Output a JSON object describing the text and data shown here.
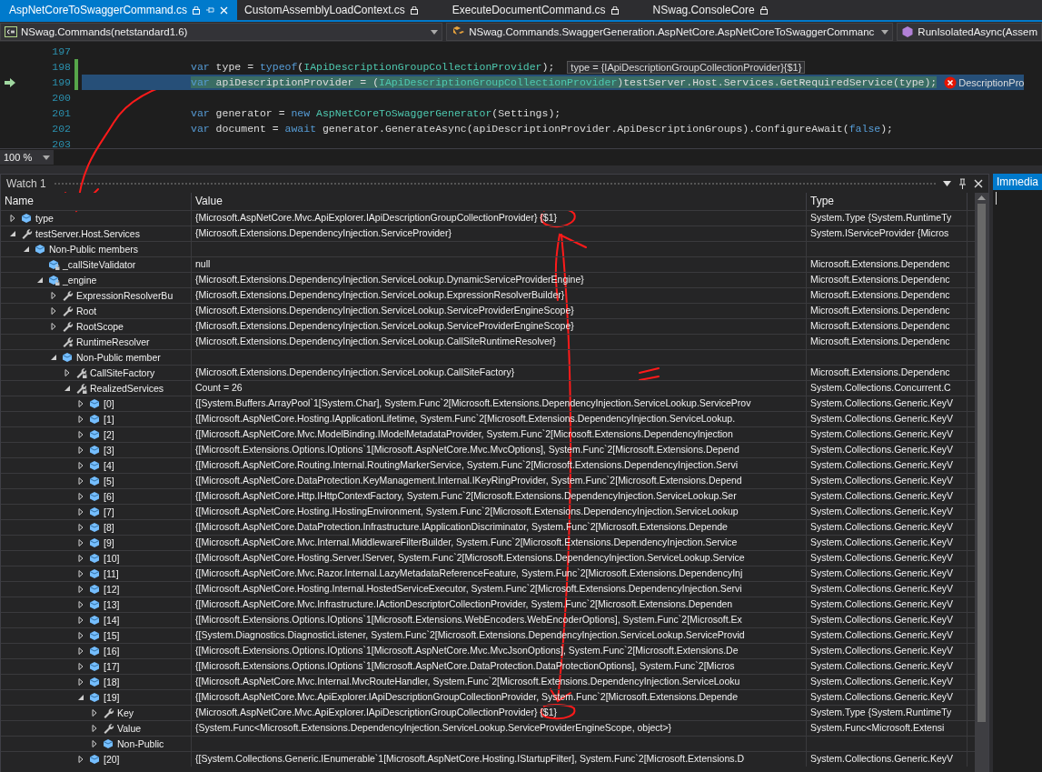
{
  "tabs": [
    {
      "label": "AspNetCoreToSwaggerCommand.cs",
      "selected": true,
      "pinnable": true
    },
    {
      "label": "CustomAssemblyLoadContext.cs",
      "selected": false,
      "pinnable": false
    },
    {
      "label": "ExecuteDocumentCommand.cs",
      "selected": false,
      "pinnable": false
    },
    {
      "label": "NSwag.ConsoleCore",
      "selected": false,
      "pinnable": false
    }
  ],
  "nav_bar": {
    "project": "NSwag.Commands(netstandard1.6)",
    "type": "NSwag.Commands.SwaggerGeneration.AspNetCore.AspNetCoreToSwaggerCommanc",
    "member": "RunIsolatedAsync(Assem"
  },
  "code_lines": [
    {
      "number": "197",
      "selected": false,
      "current": false,
      "changed": false
    },
    {
      "number": "198",
      "selected": false,
      "current": false,
      "changed": true,
      "tokens": [
        {
          "text": "var",
          "kind": "keyword"
        },
        {
          "text": " type = ",
          "kind": "plain"
        },
        {
          "text": "typeof",
          "kind": "keyword"
        },
        {
          "text": "(",
          "kind": "plain"
        },
        {
          "text": "IApiDescriptionGroupCollectionProvider",
          "kind": "type"
        },
        {
          "text": ");",
          "kind": "plain"
        }
      ],
      "datatip": "type = {IApiDescriptionGroupCollectionProvider}{$1}"
    },
    {
      "number": "199",
      "selected": true,
      "current": true,
      "changed": true,
      "tokens": [
        {
          "text": "var",
          "kind": "keyword"
        },
        {
          "text": " apiDescriptionProvider = (",
          "kind": "plain"
        },
        {
          "text": "IApiDescriptionGroupCollectionProvider",
          "kind": "type"
        },
        {
          "text": ")testServer.Host.Services.GetRequiredService(type);",
          "kind": "plain"
        }
      ],
      "error": "DescriptionPro"
    },
    {
      "number": "200",
      "selected": false,
      "current": false,
      "changed": false
    },
    {
      "number": "201",
      "selected": false,
      "current": false,
      "changed": false,
      "tokens": [
        {
          "text": "var",
          "kind": "keyword"
        },
        {
          "text": " generator = ",
          "kind": "plain"
        },
        {
          "text": "new",
          "kind": "keyword"
        },
        {
          "text": " AspNetCoreToSwaggerGenerator",
          "kind": "type"
        },
        {
          "text": "(Settings);",
          "kind": "plain"
        }
      ]
    },
    {
      "number": "202",
      "selected": false,
      "current": false,
      "changed": false,
      "tokens": [
        {
          "text": "var",
          "kind": "keyword"
        },
        {
          "text": " document = ",
          "kind": "plain"
        },
        {
          "text": "await",
          "kind": "keyword"
        },
        {
          "text": " generator.GenerateAsync(apiDescriptionProvider.ApiDescriptionGroups).ConfigureAwait(",
          "kind": "plain"
        },
        {
          "text": "false",
          "kind": "keyword"
        },
        {
          "text": ");",
          "kind": "plain"
        }
      ]
    },
    {
      "number": "203",
      "selected": false,
      "current": false,
      "changed": false
    }
  ],
  "zoom": "100 %",
  "watch": {
    "title": "Watch 1",
    "columns": [
      "Name",
      "Value",
      "Type"
    ],
    "rows": [
      {
        "name": "type",
        "value": "{Microsoft.AspNetCore.Mvc.ApiExplorer.IApiDescriptionGroupCollectionProvider} {$1}",
        "type": "System.Type {System.RuntimeTy",
        "kind": "object",
        "expanded": false
      },
      {
        "name": "testServer.Host.Services",
        "value": "{Microsoft.Extensions.DependencyInjection.ServiceProvider}",
        "type": "System.IServiceProvider {Micros",
        "kind": "property",
        "expanded": true,
        "children": [
          {
            "name": "Non-Public members",
            "kind": "object",
            "expanded": true,
            "children": [
              {
                "name": "_callSiteValidator",
                "value": "null",
                "type": "Microsoft.Extensions.Dependenc",
                "kind": "private-field"
              },
              {
                "name": "_engine",
                "value": "{Microsoft.Extensions.DependencyInjection.ServiceLookup.DynamicServiceProviderEngine}",
                "type": "Microsoft.Extensions.Dependenc",
                "kind": "private-field",
                "expanded": true,
                "children": [
                  {
                    "name": "ExpressionResolverBu",
                    "value": "{Microsoft.Extensions.DependencyInjection.ServiceLookup.ExpressionResolverBuilder}",
                    "type": "Microsoft.Extensions.Dependenc",
                    "kind": "property",
                    "expanded": false
                  },
                  {
                    "name": "Root",
                    "value": "{Microsoft.Extensions.DependencyInjection.ServiceLookup.ServiceProviderEngineScope}",
                    "type": "Microsoft.Extensions.Dependenc",
                    "kind": "property",
                    "expanded": false
                  },
                  {
                    "name": "RootScope",
                    "value": "{Microsoft.Extensions.DependencyInjection.ServiceLookup.ServiceProviderEngineScope}",
                    "type": "Microsoft.Extensions.Dependenc",
                    "kind": "property",
                    "expanded": false
                  },
                  {
                    "name": "RuntimeResolver",
                    "value": "{Microsoft.Extensions.DependencyInjection.ServiceLookup.CallSiteRuntimeResolver}",
                    "type": "Microsoft.Extensions.Dependenc",
                    "kind": "static-property"
                  },
                  {
                    "name": "Non-Public member",
                    "kind": "object",
                    "expanded": true,
                    "children": [
                      {
                        "name": "CallSiteFactory",
                        "value": "{Microsoft.Extensions.DependencyInjection.ServiceLookup.CallSiteFactory}",
                        "type": "Microsoft.Extensions.Dependenc",
                        "kind": "private-property",
                        "expanded": false
                      },
                      {
                        "name": "RealizedServices",
                        "value": "Count = 26",
                        "type": "System.Collections.Concurrent.C",
                        "kind": "private-property",
                        "expanded": true,
                        "children": [
                          {
                            "name": "[0]",
                            "value": "{[System.Buffers.ArrayPool`1[System.Char], System.Func`2[Microsoft.Extensions.DependencyInjection.ServiceLookup.ServiceProv",
                            "type": "System.Collections.Generic.KeyV",
                            "kind": "object",
                            "expanded": false
                          },
                          {
                            "name": "[1]",
                            "value": "{[Microsoft.AspNetCore.Hosting.IApplicationLifetime, System.Func`2[Microsoft.Extensions.DependencyInjection.ServiceLookup.",
                            "type": "System.Collections.Generic.KeyV",
                            "kind": "object",
                            "expanded": false
                          },
                          {
                            "name": "[2]",
                            "value": "{[Microsoft.AspNetCore.Mvc.ModelBinding.IModelMetadataProvider, System.Func`2[Microsoft.Extensions.DependencyInjection",
                            "type": "System.Collections.Generic.KeyV",
                            "kind": "object",
                            "expanded": false
                          },
                          {
                            "name": "[3]",
                            "value": "{[Microsoft.Extensions.Options.IOptions`1[Microsoft.AspNetCore.Mvc.MvcOptions], System.Func`2[Microsoft.Extensions.Depend",
                            "type": "System.Collections.Generic.KeyV",
                            "kind": "object",
                            "expanded": false
                          },
                          {
                            "name": "[4]",
                            "value": "{[Microsoft.AspNetCore.Routing.Internal.RoutingMarkerService, System.Func`2[Microsoft.Extensions.DependencyInjection.Servi",
                            "type": "System.Collections.Generic.KeyV",
                            "kind": "object",
                            "expanded": false
                          },
                          {
                            "name": "[5]",
                            "value": "{[Microsoft.AspNetCore.DataProtection.KeyManagement.Internal.IKeyRingProvider, System.Func`2[Microsoft.Extensions.Depend",
                            "type": "System.Collections.Generic.KeyV",
                            "kind": "object",
                            "expanded": false
                          },
                          {
                            "name": "[6]",
                            "value": "{[Microsoft.AspNetCore.Http.IHttpContextFactory, System.Func`2[Microsoft.Extensions.DependencyInjection.ServiceLookup.Ser",
                            "type": "System.Collections.Generic.KeyV",
                            "kind": "object",
                            "expanded": false
                          },
                          {
                            "name": "[7]",
                            "value": "{[Microsoft.AspNetCore.Hosting.IHostingEnvironment, System.Func`2[Microsoft.Extensions.DependencyInjection.ServiceLookup",
                            "type": "System.Collections.Generic.KeyV",
                            "kind": "object",
                            "expanded": false
                          },
                          {
                            "name": "[8]",
                            "value": "{[Microsoft.AspNetCore.DataProtection.Infrastructure.IApplicationDiscriminator, System.Func`2[Microsoft.Extensions.Depende",
                            "type": "System.Collections.Generic.KeyV",
                            "kind": "object",
                            "expanded": false
                          },
                          {
                            "name": "[9]",
                            "value": "{[Microsoft.AspNetCore.Mvc.Internal.MiddlewareFilterBuilder, System.Func`2[Microsoft.Extensions.DependencyInjection.Service",
                            "type": "System.Collections.Generic.KeyV",
                            "kind": "object",
                            "expanded": false
                          },
                          {
                            "name": "[10]",
                            "value": "{[Microsoft.AspNetCore.Hosting.Server.IServer, System.Func`2[Microsoft.Extensions.DependencyInjection.ServiceLookup.Service",
                            "type": "System.Collections.Generic.KeyV",
                            "kind": "object",
                            "expanded": false
                          },
                          {
                            "name": "[11]",
                            "value": "{[Microsoft.AspNetCore.Mvc.Razor.Internal.LazyMetadataReferenceFeature, System.Func`2[Microsoft.Extensions.DependencyInj",
                            "type": "System.Collections.Generic.KeyV",
                            "kind": "object",
                            "expanded": false
                          },
                          {
                            "name": "[12]",
                            "value": "{[Microsoft.AspNetCore.Hosting.Internal.HostedServiceExecutor, System.Func`2[Microsoft.Extensions.DependencyInjection.Servi",
                            "type": "System.Collections.Generic.KeyV",
                            "kind": "object",
                            "expanded": false
                          },
                          {
                            "name": "[13]",
                            "value": "{[Microsoft.AspNetCore.Mvc.Infrastructure.IActionDescriptorCollectionProvider, System.Func`2[Microsoft.Extensions.Dependen",
                            "type": "System.Collections.Generic.KeyV",
                            "kind": "object",
                            "expanded": false
                          },
                          {
                            "name": "[14]",
                            "value": "{[Microsoft.Extensions.Options.IOptions`1[Microsoft.Extensions.WebEncoders.WebEncoderOptions], System.Func`2[Microsoft.Ex",
                            "type": "System.Collections.Generic.KeyV",
                            "kind": "object",
                            "expanded": false
                          },
                          {
                            "name": "[15]",
                            "value": "{[System.Diagnostics.DiagnosticListener, System.Func`2[Microsoft.Extensions.DependencyInjection.ServiceLookup.ServiceProvid",
                            "type": "System.Collections.Generic.KeyV",
                            "kind": "object",
                            "expanded": false
                          },
                          {
                            "name": "[16]",
                            "value": "{[Microsoft.Extensions.Options.IOptions`1[Microsoft.AspNetCore.Mvc.MvcJsonOptions], System.Func`2[Microsoft.Extensions.De",
                            "type": "System.Collections.Generic.KeyV",
                            "kind": "object",
                            "expanded": false
                          },
                          {
                            "name": "[17]",
                            "value": "{[Microsoft.Extensions.Options.IOptions`1[Microsoft.AspNetCore.DataProtection.DataProtectionOptions], System.Func`2[Micros",
                            "type": "System.Collections.Generic.KeyV",
                            "kind": "object",
                            "expanded": false
                          },
                          {
                            "name": "[18]",
                            "value": "{[Microsoft.AspNetCore.Mvc.Internal.MvcRouteHandler, System.Func`2[Microsoft.Extensions.DependencyInjection.ServiceLooku",
                            "type": "System.Collections.Generic.KeyV",
                            "kind": "object",
                            "expanded": false
                          },
                          {
                            "name": "[19]",
                            "value": "{[Microsoft.AspNetCore.Mvc.ApiExplorer.IApiDescriptionGroupCollectionProvider, System.Func`2[Microsoft.Extensions.Depende",
                            "type": "System.Collections.Generic.KeyV",
                            "kind": "object",
                            "expanded": true,
                            "children": [
                              {
                                "name": "Key",
                                "value": "{Microsoft.AspNetCore.Mvc.ApiExplorer.IApiDescriptionGroupCollectionProvider} {$1}",
                                "type": "System.Type {System.RuntimeTy",
                                "kind": "property",
                                "expanded": false
                              },
                              {
                                "name": "Value",
                                "value": "{System.Func<Microsoft.Extensions.DependencyInjection.ServiceLookup.ServiceProviderEngineScope, object>}",
                                "type": "System.Func<Microsoft.Extensi",
                                "kind": "property",
                                "expanded": false
                              },
                              {
                                "name": "Non-Public",
                                "kind": "object",
                                "expanded": false
                              }
                            ]
                          },
                          {
                            "name": "[20]",
                            "value": "{[System.Collections.Generic.IEnumerable`1[Microsoft.AspNetCore.Hosting.IStartupFilter], System.Func`2[Microsoft.Extensions.D",
                            "type": "System.Collections.Generic.KeyV",
                            "kind": "object",
                            "expanded": false
                          }
                        ]
                      }
                    ]
                  }
                ]
              }
            ]
          }
        ]
      }
    ]
  },
  "immediate": {
    "title": "Immedia"
  }
}
